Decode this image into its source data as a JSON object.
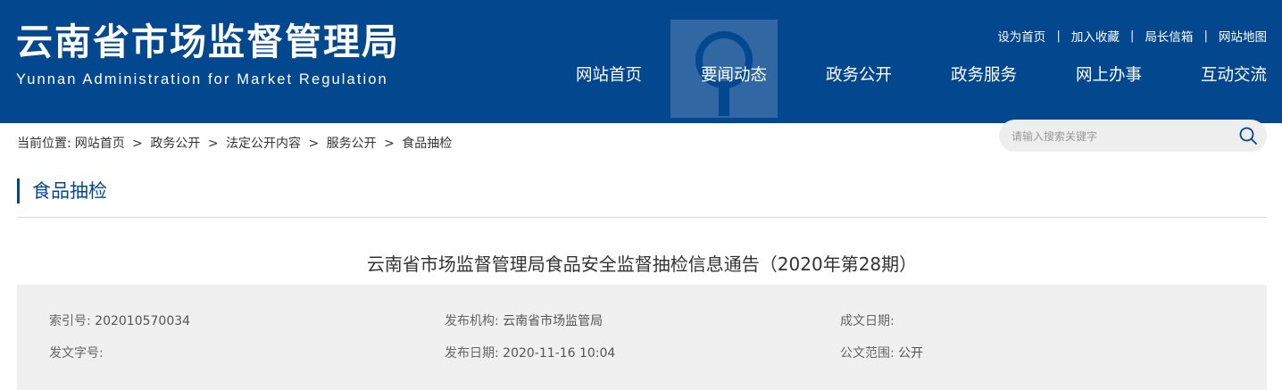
{
  "header": {
    "title_cn": "云南省市场监督管理局",
    "title_en": "Yunnan Administration for Market Regulation",
    "toplinks": [
      "设为首页",
      "加入收藏",
      "局长信箱",
      "网站地图"
    ],
    "separator": "|",
    "nav": [
      "网站首页",
      "要闻动态",
      "政务公开",
      "政务服务",
      "网上办事",
      "互动交流"
    ],
    "colors": {
      "primary": "#03478f"
    }
  },
  "breadcrumb": {
    "prefix": "当前位置:",
    "items": [
      "网站首页",
      "政务公开",
      "法定公开内容",
      "服务公开",
      "食品抽检"
    ],
    "separator": ">"
  },
  "search": {
    "placeholder": "请输入搜索关键字",
    "icon": "search-icon"
  },
  "section": {
    "title": "食品抽检"
  },
  "article": {
    "title": "云南省市场监督管理局食品安全监督抽检信息通告（2020年第28期）",
    "meta": {
      "index_label": "索引号:",
      "index_value": "202010570034",
      "publisher_label": "发布机构:",
      "publisher_value": "云南省市场监管局",
      "date_written_label": "成文日期:",
      "date_written_value": "",
      "doc_number_label": "发文字号:",
      "doc_number_value": "",
      "publish_date_label": "发布日期:",
      "publish_date_value": "2020-11-16 10:04",
      "scope_label": "公文范围:",
      "scope_value": "公开"
    }
  }
}
